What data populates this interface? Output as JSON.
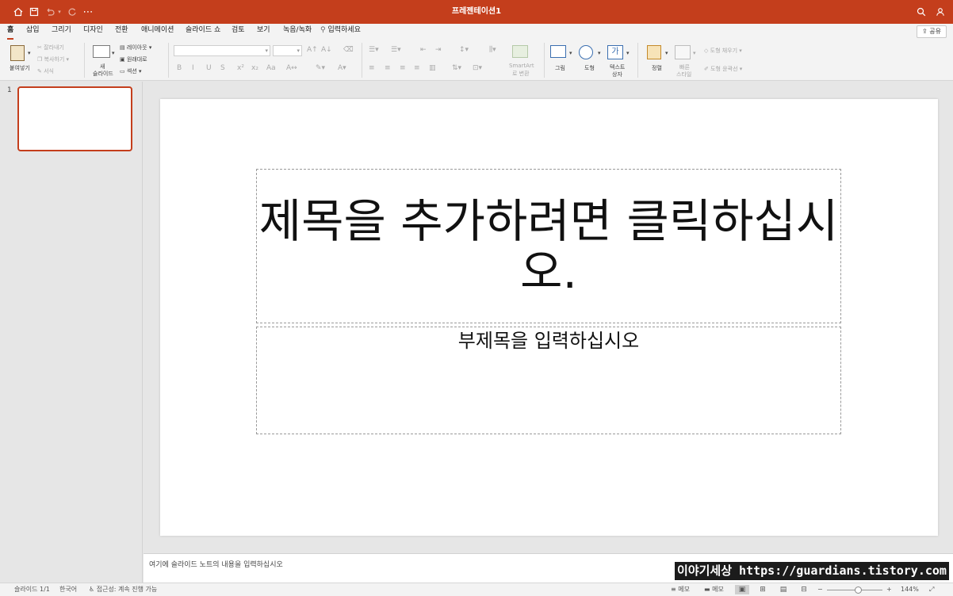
{
  "titlebar": {
    "title": "프레젠테이션1",
    "bg_color": "#c43e1c",
    "quick_access": [
      "home-icon",
      "save-icon",
      "undo-icon",
      "redo-icon",
      "more-icon"
    ],
    "right_icons": [
      "search-icon",
      "account-icon"
    ]
  },
  "tabs": [
    {
      "label": "홈",
      "active": true
    },
    {
      "label": "삽입"
    },
    {
      "label": "그리기"
    },
    {
      "label": "디자인"
    },
    {
      "label": "전환"
    },
    {
      "label": "애니메이션"
    },
    {
      "label": "슬라이드 쇼"
    },
    {
      "label": "검토"
    },
    {
      "label": "보기"
    },
    {
      "label": "녹음/녹화"
    },
    {
      "label": "입력하세요"
    }
  ],
  "share_label": "공유",
  "ribbon": {
    "paste": "붙여넣기",
    "cut": "잘라내기",
    "copy": "복사하기",
    "format": "서식",
    "new_slide": "새",
    "new_slide_2": "슬라이드",
    "layout": "레이아웃",
    "reset": "원래대로",
    "section": "섹션",
    "smartart": "SmartArt",
    "smartart_2": "로 변환",
    "picture": "그림",
    "shape": "도형",
    "textbox": "텍스트",
    "textbox_2": "상자",
    "arrange": "정렬",
    "quick_styles": "빠른",
    "quick_styles_2": "스타일",
    "shape_fill": "도형 채우기",
    "shape_outline": "도형 윤곽선"
  },
  "slides_pane": {
    "slide_number": "1"
  },
  "slide": {
    "title_placeholder": "제목을 추가하려면 클릭하십시오.",
    "subtitle_placeholder": "부제목을 입력하십시오"
  },
  "notes_placeholder": "여기에 슬라이드 노트의 내용을 입력하십시오",
  "watermark": "이야기세상 https://guardians.tistory.com",
  "status": {
    "slide_counter": "슬라이드 1/1",
    "language": "한국어",
    "accessibility": "접근성: 계속 진행 가능",
    "notes_btn": "메모",
    "comments_btn": "메모",
    "zoom": "144%",
    "zoom_level_fraction": 0.55
  }
}
